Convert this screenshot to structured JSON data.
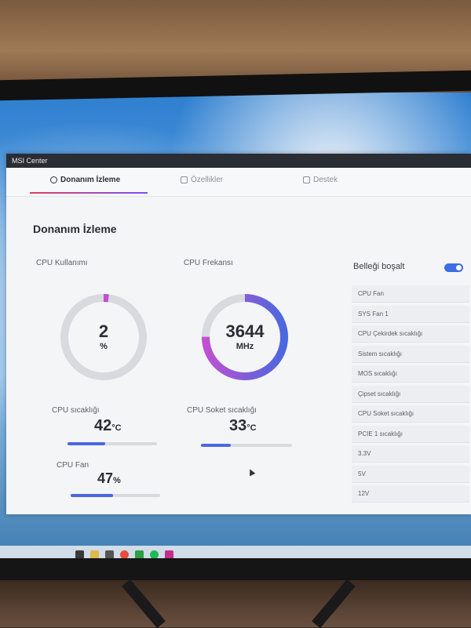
{
  "window": {
    "title": "MSI Center"
  },
  "tabs": [
    {
      "label": "Donanım İzleme",
      "icon": "gauge-icon"
    },
    {
      "label": "Özellikler",
      "icon": "features-icon"
    },
    {
      "label": "Destek",
      "icon": "support-icon"
    }
  ],
  "page": {
    "title": "Donanım İzleme"
  },
  "cpu_usage": {
    "label": "CPU Kullanımı",
    "value": "2",
    "unit": "%",
    "percent": 2
  },
  "cpu_freq": {
    "label": "CPU Frekansı",
    "value": "3644",
    "unit": "MHz",
    "fraction": 0.75
  },
  "temps": {
    "cpu_temp": {
      "label": "CPU sıcaklığı",
      "value": "42",
      "unit": "°C",
      "percent": 42
    },
    "socket_temp": {
      "label": "CPU Soket sıcaklığı",
      "value": "33",
      "unit": "°C",
      "percent": 33
    },
    "cpu_fan": {
      "label": "CPU Fan",
      "value": "47",
      "unit": "%",
      "percent": 47
    }
  },
  "memory": {
    "label": "Belleği boşalt"
  },
  "sensors": [
    "CPU Fan",
    "SYS Fan 1",
    "CPU Çekirdek sıcaklığı",
    "Sistem sıcaklığı",
    "MOS sıcaklığı",
    "Çipset sıcaklığı",
    "CPU Soket sıcaklığı",
    "PCIE 1 sıcaklığı",
    "3.3V",
    "5V",
    "12V"
  ],
  "colors": {
    "accent": "#4a68e0",
    "gauge_top": "#c050d0",
    "track": "#d8dade"
  }
}
